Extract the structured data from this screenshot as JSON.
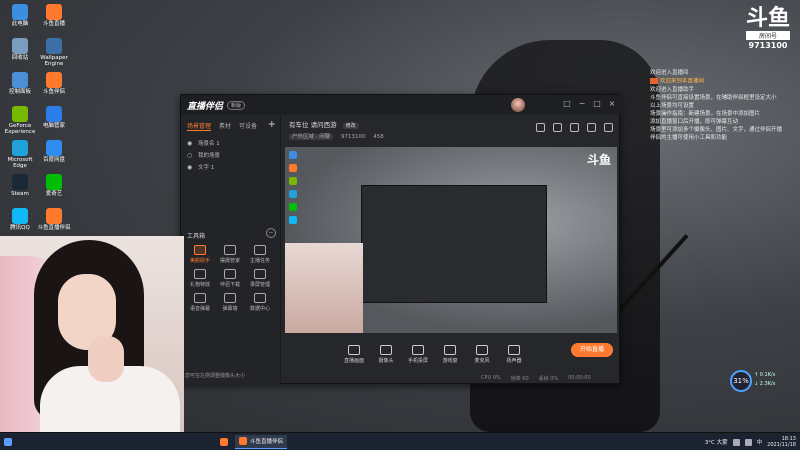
{
  "desktop": {
    "icons": [
      {
        "label": "此电脑",
        "color": "#3b8ee0"
      },
      {
        "label": "斗鱼直播",
        "color": "#ff7a2e"
      },
      {
        "label": "回收站",
        "color": "#7a9cc0"
      },
      {
        "label": "Wallpaper Engine",
        "color": "#3c6ea8"
      },
      {
        "label": "控制面板",
        "color": "#4a90d9"
      },
      {
        "label": "斗鱼伴侣",
        "color": "#ff7a2e"
      },
      {
        "label": "GeForce Experience",
        "color": "#76b900"
      },
      {
        "label": "电脑管家",
        "color": "#2b7de9"
      },
      {
        "label": "Microsoft Edge",
        "color": "#1fa2d8"
      },
      {
        "label": "百度网盘",
        "color": "#2f8cf0"
      },
      {
        "label": "Steam",
        "color": "#1b2838"
      },
      {
        "label": "爱奇艺",
        "color": "#00be06"
      },
      {
        "label": "腾讯QQ",
        "color": "#12b7f5"
      },
      {
        "label": "斗鱼直播伴侣",
        "color": "#ff7a2e"
      }
    ]
  },
  "overlay": {
    "logo_big": "斗鱼",
    "logo_sub": "房间号",
    "room_number": "9713100",
    "chat": [
      {
        "text": "欢迎进入直播间",
        "highlight": ""
      },
      {
        "text": "",
        "highlight": "欢迎来到本直播间"
      },
      {
        "text": "",
        "highlight": ""
      },
      {
        "text": "欢迎进入直播助手",
        "highlight": ""
      },
      {
        "text": "斗鱼伴侣可直接设置场景，在辅助伴侣框里设定大小",
        "highlight": ""
      },
      {
        "text": "以上场景均可设置",
        "highlight": ""
      },
      {
        "text": "场景操作指南：新建场景，在场景中添加图片",
        "highlight": ""
      },
      {
        "text": "添加直播窗口后开播，即可弹幕互动",
        "highlight": ""
      },
      {
        "text": "",
        "highlight": ""
      },
      {
        "text": "场景里可添加多个摄像头、图片、文字，通过伴侣开播",
        "highlight": ""
      },
      {
        "text": "伴侣的主播可使用小工具和功能",
        "highlight": ""
      }
    ]
  },
  "app": {
    "logo": "直播伴侣",
    "version": "新版",
    "window_controls": [
      "□",
      "−",
      "□",
      "×"
    ],
    "sidebar_tabs": [
      "场景管理",
      "素材",
      "可设备"
    ],
    "add_label": "+",
    "scenes": [
      {
        "name": "场景名 1",
        "visible": true
      },
      {
        "name": "我的场景",
        "visible": false
      },
      {
        "name": "文字 1",
        "visible": true
      }
    ],
    "tools_title": "工具箱",
    "tools_close": "−",
    "tools": [
      {
        "label": "美颜助手",
        "active": true
      },
      {
        "label": "摆摄管家",
        "active": false
      },
      {
        "label": "主播任务",
        "active": false
      },
      {
        "label": "礼物特效",
        "active": false
      },
      {
        "label": "伴侣下载",
        "active": false
      },
      {
        "label": "录屏管理",
        "active": false
      },
      {
        "label": "语音弹幕",
        "active": false
      },
      {
        "label": "弹幕墙",
        "active": false
      },
      {
        "label": "数据中心",
        "active": false
      }
    ],
    "sidebar_notice": "您可在左侧调整摄像头大小",
    "room": {
      "title": "有车位",
      "subtitle": "请问西游",
      "edit": "修改",
      "category": "户外区域 · 闲聊",
      "room_id": "9713100",
      "viewers": "458"
    },
    "preview_logo": "斗鱼",
    "bottom_tools": [
      "直播画面",
      "摄像头",
      "手机投屏",
      "游戏窗",
      "麦克风",
      "扬声器"
    ],
    "start_label": "开始直播",
    "status": [
      "CPU 9%",
      "帧率 60",
      "丢帧 0%",
      "00:00:00"
    ]
  },
  "gauge": {
    "value": "31%",
    "up": "↑ 0.1K/s",
    "down": "↓ 2.3K/s"
  },
  "taskbar": {
    "items": [
      {
        "label": "",
        "color": "#ff7a2e"
      },
      {
        "label": "斗鱼直播伴侣",
        "color": "#ff7a2e"
      }
    ],
    "weather": "3°C 大雾",
    "lang": "中",
    "time": "18:13",
    "date": "2021/11/18"
  }
}
